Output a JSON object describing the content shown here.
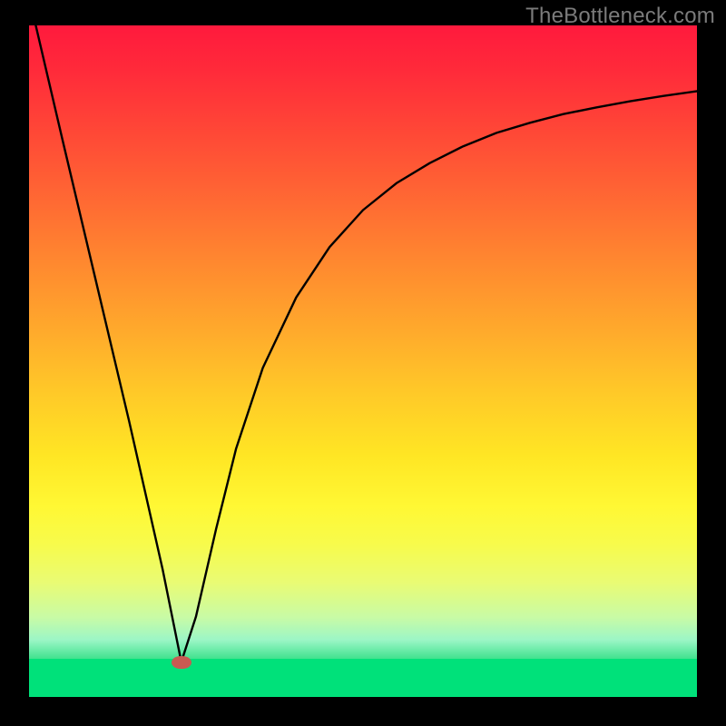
{
  "watermark": "TheBottleneck.com",
  "marker": {
    "x_pct": 22.8,
    "y_pct": 94.8
  },
  "colors": {
    "background": "#000000",
    "curve": "#000000",
    "marker": "#c85a52",
    "green": "#00e17a",
    "top": "#ff1a3d"
  },
  "chart_data": {
    "type": "line",
    "title": "",
    "xlabel": "",
    "ylabel": "",
    "xlim": [
      0,
      100
    ],
    "ylim": [
      0,
      100
    ],
    "grid": false,
    "legend": false,
    "note": "Values estimated from pixel positions; axes unlabeled in source.",
    "series": [
      {
        "name": "bottleneck-curve",
        "x": [
          1.0,
          5.0,
          10.0,
          15.0,
          20.0,
          22.8,
          25.0,
          28.0,
          31.0,
          35.0,
          40.0,
          45.0,
          50.0,
          55.0,
          60.0,
          65.0,
          70.0,
          75.0,
          80.0,
          85.0,
          90.0,
          95.0,
          100.0
        ],
        "y": [
          100.0,
          83.0,
          62.0,
          41.0,
          19.0,
          5.2,
          12.0,
          25.0,
          37.0,
          49.0,
          59.5,
          67.0,
          72.5,
          76.5,
          79.5,
          82.0,
          84.0,
          85.5,
          86.8,
          87.8,
          88.7,
          89.5,
          90.2
        ]
      }
    ],
    "marker_point": {
      "x": 22.8,
      "y": 5.2
    },
    "background_gradient_stops": [
      {
        "pct": 0,
        "color": "#ff1a3d"
      },
      {
        "pct": 50,
        "color": "#ffb92b"
      },
      {
        "pct": 80,
        "color": "#f9fa3f"
      },
      {
        "pct": 100,
        "color": "#00e17a"
      }
    ]
  }
}
